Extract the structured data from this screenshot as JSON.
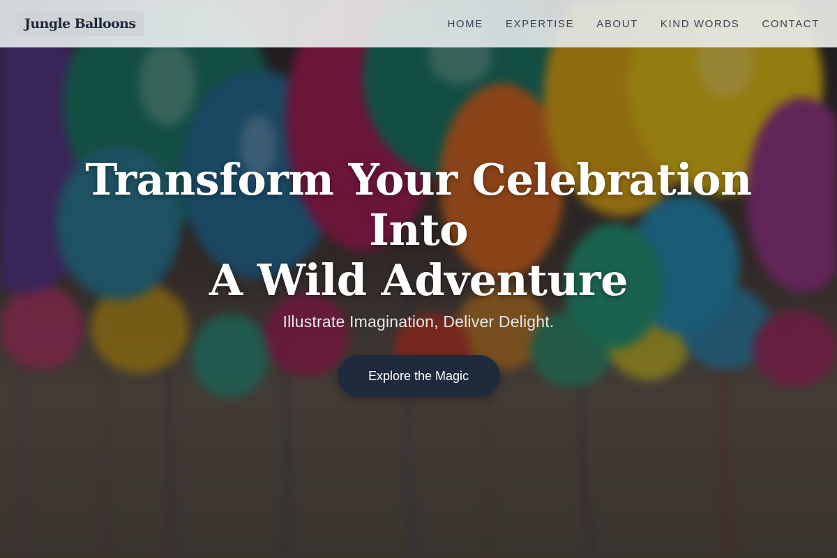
{
  "brand": {
    "name": "Jungle Balloons"
  },
  "nav": {
    "items": [
      {
        "label": "HOME"
      },
      {
        "label": "EXPERTISE"
      },
      {
        "label": "ABOUT"
      },
      {
        "label": "KIND WORDS"
      },
      {
        "label": "CONTACT"
      }
    ]
  },
  "hero": {
    "title_lines": [
      "Transform Your Celebration",
      "Into",
      "A Wild Adventure"
    ],
    "subtitle": "Illustrate Imagination, Deliver Delight.",
    "cta_label": "Explore the Magic",
    "background_image": "colorful-balloons-photo"
  },
  "colors": {
    "header_bg": "#e6e9ea",
    "nav_text": "#374151",
    "cta_bg": "#1f2a3d",
    "hero_text": "#ffffff"
  }
}
